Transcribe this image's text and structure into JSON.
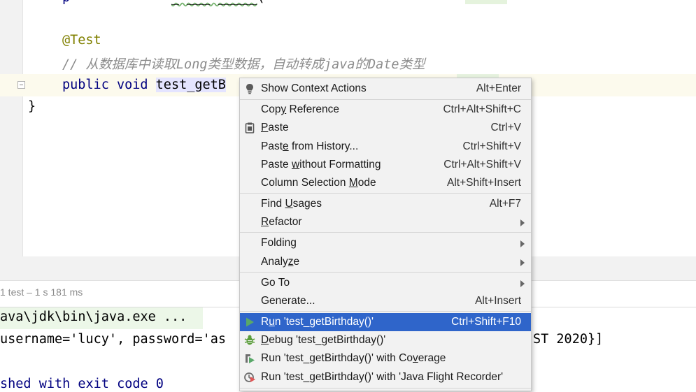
{
  "editor": {
    "annotation": "@Test",
    "comment": "// 从数据库中读取Long类型数据，自动转成java的Date类型",
    "method_keywords": "public void",
    "method_name_visible": "test_getB",
    "closing_brace": "}"
  },
  "run_panel": {
    "test_summary": "1 test – 1 s 181 ms",
    "console_lines": [
      "ava\\jdk\\bin\\java.exe ...",
      "username='lucy', password='as",
      "",
      "shed with exit code 0"
    ],
    "console_tail": "ST 2020}]"
  },
  "context_menu": {
    "items": [
      {
        "label_pre": "Show Context Actions",
        "mnemonic": "",
        "label_post": "",
        "shortcut": "Alt+Enter",
        "icon": "lightbulb-icon"
      },
      {
        "label_pre": "Cop",
        "mnemonic": "y",
        "label_post": " Reference",
        "shortcut": "Ctrl+Alt+Shift+C",
        "icon": ""
      },
      {
        "label_pre": "",
        "mnemonic": "P",
        "label_post": "aste",
        "shortcut": "Ctrl+V",
        "icon": "clipboard-icon"
      },
      {
        "label_pre": "Past",
        "mnemonic": "e",
        "label_post": " from History...",
        "shortcut": "Ctrl+Shift+V",
        "icon": ""
      },
      {
        "label_pre": "Paste ",
        "mnemonic": "w",
        "label_post": "ithout Formatting",
        "shortcut": "Ctrl+Alt+Shift+V",
        "icon": ""
      },
      {
        "label_pre": "Column Selection ",
        "mnemonic": "M",
        "label_post": "ode",
        "shortcut": "Alt+Shift+Insert",
        "icon": ""
      },
      {
        "label_pre": "Find ",
        "mnemonic": "U",
        "label_post": "sages",
        "shortcut": "Alt+F7",
        "icon": ""
      },
      {
        "label_pre": "",
        "mnemonic": "R",
        "label_post": "efactor",
        "shortcut": "",
        "icon": "",
        "submenu": true
      },
      {
        "label_pre": "Folding",
        "mnemonic": "",
        "label_post": "",
        "shortcut": "",
        "icon": "",
        "submenu": true
      },
      {
        "label_pre": "Analy",
        "mnemonic": "z",
        "label_post": "e",
        "shortcut": "",
        "icon": "",
        "submenu": true
      },
      {
        "label_pre": "Go To",
        "mnemonic": "",
        "label_post": "",
        "shortcut": "",
        "icon": "",
        "submenu": true
      },
      {
        "label_pre": "Generate...",
        "mnemonic": "",
        "label_post": "",
        "shortcut": "Alt+Insert",
        "icon": ""
      },
      {
        "label_pre": "R",
        "mnemonic": "u",
        "label_post": "n 'test_getBirthday()'",
        "shortcut": "Ctrl+Shift+F10",
        "icon": "run-icon"
      },
      {
        "label_pre": "",
        "mnemonic": "D",
        "label_post": "ebug 'test_getBirthday()'",
        "shortcut": "",
        "icon": "debug-icon"
      },
      {
        "label_pre": "Run 'test_getBirthday()' with Co",
        "mnemonic": "v",
        "label_post": "erage",
        "shortcut": "",
        "icon": "coverage-icon"
      },
      {
        "label_pre": "Run 'test_getBirthday()' with 'Java Flight Recorder'",
        "mnemonic": "",
        "label_post": "",
        "shortcut": "",
        "icon": "profiler-icon"
      }
    ]
  },
  "colors": {
    "selection": "#2f65ca",
    "menu_bg": "#f2f2f2",
    "keyword": "#000080",
    "annotation": "#808000",
    "comment": "#8c8c8c",
    "run_green": "#4caf50",
    "debug_green": "#5a9d3a"
  }
}
